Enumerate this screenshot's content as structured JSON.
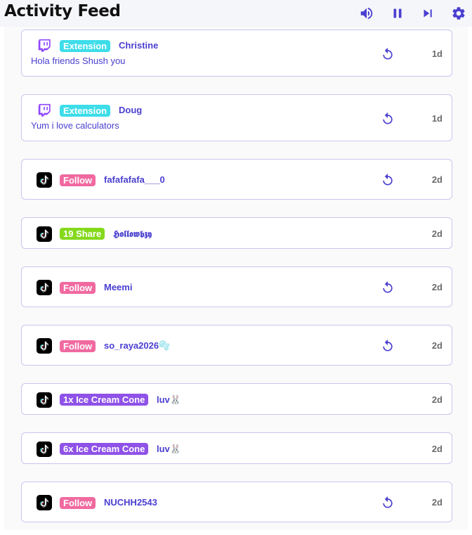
{
  "header": {
    "title": "Activity Feed"
  },
  "colors": {
    "accent": "#4a3fd0",
    "twitch": "#9146ff",
    "tiktok_bg": "#000000",
    "badge_extension": "#3ddde9",
    "badge_follow": "#f06aa0",
    "badge_share": "#84d91b",
    "badge_gift": "#8f52e8"
  },
  "feed": [
    {
      "platform": "twitch-icon",
      "badge": "Extension",
      "badge_type": "extension",
      "user": "Christine",
      "message": "Hola friends Shush you",
      "replay": true,
      "time": "1d"
    },
    {
      "platform": "twitch-icon",
      "badge": "Extension",
      "badge_type": "extension",
      "user": "Doug",
      "message": "Yum i love calculators",
      "replay": true,
      "time": "1d"
    },
    {
      "platform": "tiktok-icon",
      "badge": "Follow",
      "badge_type": "follow",
      "user": "fafafafafa___0",
      "message": "",
      "replay": true,
      "time": "2d"
    },
    {
      "platform": "tiktok-icon",
      "badge": "19 Share",
      "badge_type": "share",
      "user": "𝕳𝖔𝖑𝖑𝖔𝖜𝖇𝖟𝖞",
      "message": "",
      "replay": false,
      "time": "2d"
    },
    {
      "platform": "tiktok-icon",
      "badge": "Follow",
      "badge_type": "follow",
      "user": "Meemi",
      "message": "",
      "replay": true,
      "time": "2d"
    },
    {
      "platform": "tiktok-icon",
      "badge": "Follow",
      "badge_type": "follow",
      "user": "so_raya2026🫧",
      "message": "",
      "replay": true,
      "time": "2d"
    },
    {
      "platform": "tiktok-icon",
      "badge": "1x Ice Cream Cone",
      "badge_type": "gift",
      "user": "luv🐰",
      "message": "",
      "replay": false,
      "time": "2d"
    },
    {
      "platform": "tiktok-icon",
      "badge": "6x Ice Cream Cone",
      "badge_type": "gift",
      "user": "luv🐰",
      "message": "",
      "replay": false,
      "time": "2d"
    },
    {
      "platform": "tiktok-icon",
      "badge": "Follow",
      "badge_type": "follow",
      "user": "NUCHH2543",
      "message": "",
      "replay": true,
      "time": "2d"
    }
  ]
}
